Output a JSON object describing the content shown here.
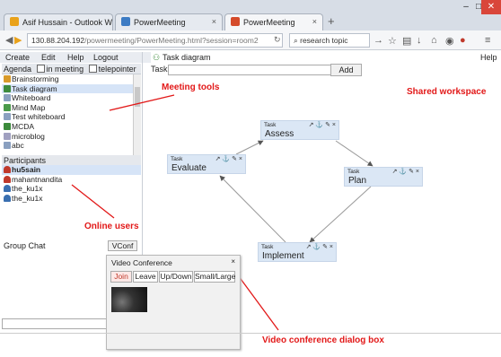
{
  "browser": {
    "tabs": [
      {
        "label": "Asif Hussain - Outlook We...",
        "icon_color": "#e9a21b"
      },
      {
        "label": "PowerMeeting",
        "icon_color": "#3c7bc4"
      },
      {
        "label": "PowerMeeting",
        "icon_color": "#d54b2b"
      }
    ],
    "new_tab_label": "+",
    "url_host": "130.88.204.192",
    "url_path": "/powermeeting/PowerMeeting.html?session=room2",
    "search_value": "research topic",
    "window_minimize": "–",
    "window_maximize": "□",
    "window_close": "✕"
  },
  "app": {
    "menu": [
      "Create",
      "Edit",
      "Help",
      "Logout"
    ],
    "workspace_title": "Task diagram",
    "help_label": "Help",
    "task_label": "Task:",
    "task_input_value": "",
    "add_button": "Add",
    "agenda": {
      "title": "Agenda",
      "in_meeting_label": "in meeting",
      "telepointer_label": "telepointer",
      "items": [
        {
          "label": "Brainstorming",
          "icon": "brainstorm-icon",
          "color": "#d89a2a",
          "selected": false
        },
        {
          "label": "Task diagram",
          "icon": "task-diagram-icon",
          "color": "#3d8b3d",
          "selected": true
        },
        {
          "label": "Whiteboard",
          "icon": "whiteboard-icon",
          "color": "#8aa0c0",
          "selected": false
        },
        {
          "label": "Mind Map",
          "icon": "mind-map-icon",
          "color": "#4a9a4a",
          "selected": false
        },
        {
          "label": "Test whiteboard",
          "icon": "whiteboard-icon",
          "color": "#8aa0c0",
          "selected": false
        },
        {
          "label": "MCDA",
          "icon": "mcda-icon",
          "color": "#3b8a3b",
          "selected": false
        },
        {
          "label": "microblog",
          "icon": "microblog-icon",
          "color": "#a0a0c0",
          "selected": false
        },
        {
          "label": "abc",
          "icon": "whiteboard-icon",
          "color": "#8aa0c0",
          "selected": false
        }
      ]
    },
    "participants": {
      "title": "Participants",
      "users": [
        {
          "name": "hu5sain",
          "color": "#c0392b",
          "selected": true
        },
        {
          "name": "mahantnandita",
          "color": "#c0392b",
          "selected": false
        },
        {
          "name": "the_ku1x",
          "color": "#3a6fb0",
          "selected": false
        },
        {
          "name": "the_ku1x",
          "color": "#3a6fb0",
          "selected": false
        }
      ]
    },
    "group_chat": {
      "title": "Group Chat",
      "vconf_button": "VConf",
      "input_value": ""
    },
    "tasks": [
      {
        "label": "Task",
        "name": "Assess"
      },
      {
        "label": "Task",
        "name": "Evaluate"
      },
      {
        "label": "Task",
        "name": "Plan"
      },
      {
        "label": "Task",
        "name": "Implement"
      }
    ],
    "task_icons": "↗ ⚓ ✎ ×",
    "video_conference": {
      "title": "Video Conference",
      "close": "×",
      "buttons": [
        "Join",
        "Leave",
        "Up/Down",
        "Small/Large"
      ]
    }
  },
  "annotations": {
    "meeting_tools": "Meeting tools",
    "shared_workspace": "Shared workspace",
    "online_users": "Online users",
    "video_dialog": "Video conference dialog box"
  },
  "colors": {
    "annotation": "#e21818",
    "selection": "#d6e4f7",
    "task_box": "#dbe7f5"
  }
}
